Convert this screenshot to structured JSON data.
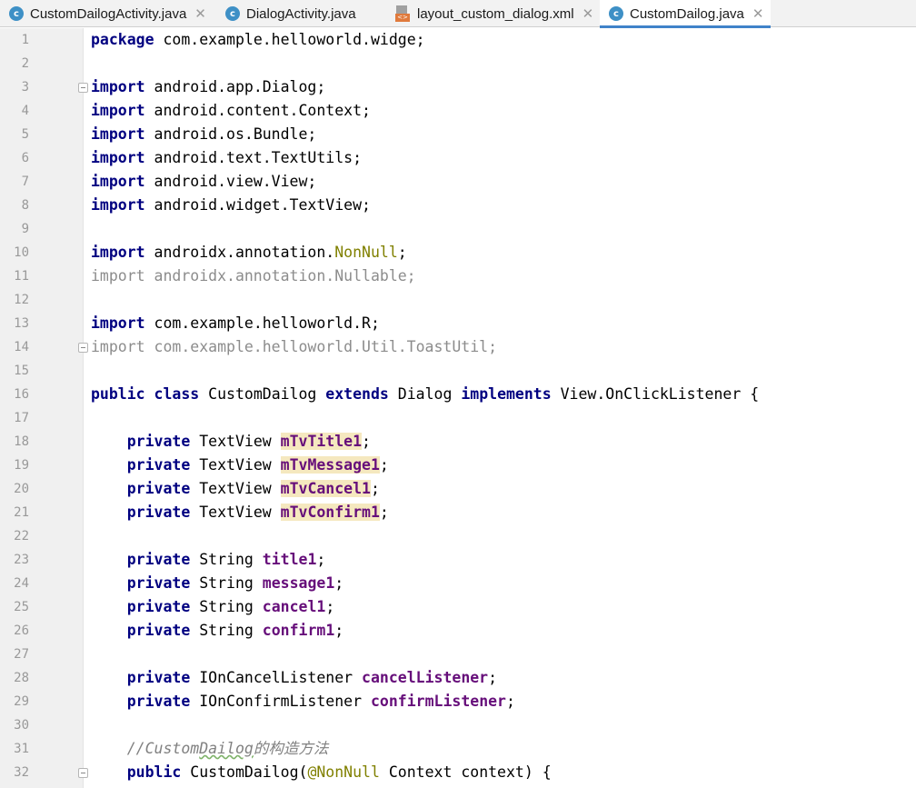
{
  "tabs": [
    {
      "label": "CustomDailogActivity.java",
      "icon": "java-class-icon",
      "icon_glyph": "c",
      "active": false,
      "closable": true
    },
    {
      "label": "DialogActivity.java",
      "icon": "java-class-icon",
      "icon_glyph": "c",
      "active": false,
      "closable": false
    },
    {
      "label": "layout_custom_dialog.xml",
      "icon": "xml-file-icon",
      "icon_glyph": "<>",
      "active": false,
      "closable": true
    },
    {
      "label": "CustomDailog.java",
      "icon": "java-class-icon",
      "icon_glyph": "c",
      "active": true,
      "closable": true
    }
  ],
  "tab_close_glyph": "✕",
  "colors": {
    "keyword": "#000080",
    "field": "#660e7a",
    "annotation": "#808000",
    "comment": "#808080",
    "unused": "#8c8c8c",
    "highlight": "#f5e8bf",
    "active_tab_underline": "#4083c9"
  },
  "editor": {
    "lines": [
      {
        "n": "1",
        "fold": false,
        "tokens": [
          {
            "t": "package",
            "c": "kw"
          },
          {
            "t": " com.example.helloworld.widge;"
          }
        ]
      },
      {
        "n": "2",
        "fold": false,
        "tokens": []
      },
      {
        "n": "3",
        "fold": true,
        "tokens": [
          {
            "t": "import",
            "c": "kw"
          },
          {
            "t": " android.app.Dialog;"
          }
        ]
      },
      {
        "n": "4",
        "fold": false,
        "tokens": [
          {
            "t": "import",
            "c": "kw"
          },
          {
            "t": " android.content.Context;"
          }
        ]
      },
      {
        "n": "5",
        "fold": false,
        "tokens": [
          {
            "t": "import",
            "c": "kw"
          },
          {
            "t": " android.os.Bundle;"
          }
        ]
      },
      {
        "n": "6",
        "fold": false,
        "tokens": [
          {
            "t": "import",
            "c": "kw"
          },
          {
            "t": " android.text.TextUtils;"
          }
        ]
      },
      {
        "n": "7",
        "fold": false,
        "tokens": [
          {
            "t": "import",
            "c": "kw"
          },
          {
            "t": " android.view.View;"
          }
        ]
      },
      {
        "n": "8",
        "fold": false,
        "tokens": [
          {
            "t": "import",
            "c": "kw"
          },
          {
            "t": " android.widget.TextView;"
          }
        ]
      },
      {
        "n": "9",
        "fold": false,
        "tokens": []
      },
      {
        "n": "10",
        "fold": false,
        "tokens": [
          {
            "t": "import",
            "c": "kw"
          },
          {
            "t": " androidx.annotation."
          },
          {
            "t": "NonNull",
            "c": "ann"
          },
          {
            "t": ";"
          }
        ]
      },
      {
        "n": "11",
        "fold": false,
        "tokens": [
          {
            "t": "import androidx.annotation.Nullable;",
            "c": "unused"
          }
        ]
      },
      {
        "n": "12",
        "fold": false,
        "tokens": []
      },
      {
        "n": "13",
        "fold": false,
        "tokens": [
          {
            "t": "import",
            "c": "kw"
          },
          {
            "t": " com.example.helloworld.R;"
          }
        ]
      },
      {
        "n": "14",
        "fold": true,
        "tokens": [
          {
            "t": "import com.example.helloworld.Util.ToastUtil;",
            "c": "unused"
          }
        ]
      },
      {
        "n": "15",
        "fold": false,
        "tokens": []
      },
      {
        "n": "16",
        "fold": false,
        "tokens": [
          {
            "t": "public class",
            "c": "kw"
          },
          {
            "t": " CustomDailog "
          },
          {
            "t": "extends",
            "c": "kw"
          },
          {
            "t": " Dialog "
          },
          {
            "t": "implements",
            "c": "kw"
          },
          {
            "t": " View.OnClickListener {"
          }
        ]
      },
      {
        "n": "17",
        "fold": false,
        "tokens": []
      },
      {
        "n": "18",
        "fold": false,
        "tokens": [
          {
            "t": "    "
          },
          {
            "t": "private",
            "c": "kw"
          },
          {
            "t": " TextView "
          },
          {
            "t": "mTvTitle1",
            "c": "field hl"
          },
          {
            "t": ";"
          }
        ]
      },
      {
        "n": "19",
        "fold": false,
        "tokens": [
          {
            "t": "    "
          },
          {
            "t": "private",
            "c": "kw"
          },
          {
            "t": " TextView "
          },
          {
            "t": "mTvMessage1",
            "c": "field hl"
          },
          {
            "t": ";"
          }
        ]
      },
      {
        "n": "20",
        "fold": false,
        "tokens": [
          {
            "t": "    "
          },
          {
            "t": "private",
            "c": "kw"
          },
          {
            "t": " TextView "
          },
          {
            "t": "mTvCancel1",
            "c": "field hl"
          },
          {
            "t": ";"
          }
        ]
      },
      {
        "n": "21",
        "fold": false,
        "tokens": [
          {
            "t": "    "
          },
          {
            "t": "private",
            "c": "kw"
          },
          {
            "t": " TextView "
          },
          {
            "t": "mTvConfirm1",
            "c": "field hl"
          },
          {
            "t": ";"
          }
        ]
      },
      {
        "n": "22",
        "fold": false,
        "tokens": []
      },
      {
        "n": "23",
        "fold": false,
        "tokens": [
          {
            "t": "    "
          },
          {
            "t": "private",
            "c": "kw"
          },
          {
            "t": " String "
          },
          {
            "t": "title1",
            "c": "field"
          },
          {
            "t": ";"
          }
        ]
      },
      {
        "n": "24",
        "fold": false,
        "tokens": [
          {
            "t": "    "
          },
          {
            "t": "private",
            "c": "kw"
          },
          {
            "t": " String "
          },
          {
            "t": "message1",
            "c": "field"
          },
          {
            "t": ";"
          }
        ]
      },
      {
        "n": "25",
        "fold": false,
        "tokens": [
          {
            "t": "    "
          },
          {
            "t": "private",
            "c": "kw"
          },
          {
            "t": " String "
          },
          {
            "t": "cancel1",
            "c": "field"
          },
          {
            "t": ";"
          }
        ]
      },
      {
        "n": "26",
        "fold": false,
        "tokens": [
          {
            "t": "    "
          },
          {
            "t": "private",
            "c": "kw"
          },
          {
            "t": " String "
          },
          {
            "t": "confirm1",
            "c": "field"
          },
          {
            "t": ";"
          }
        ]
      },
      {
        "n": "27",
        "fold": false,
        "tokens": []
      },
      {
        "n": "28",
        "fold": false,
        "tokens": [
          {
            "t": "    "
          },
          {
            "t": "private",
            "c": "kw"
          },
          {
            "t": " IOnCancelListener "
          },
          {
            "t": "cancelListener",
            "c": "field"
          },
          {
            "t": ";"
          }
        ]
      },
      {
        "n": "29",
        "fold": false,
        "tokens": [
          {
            "t": "    "
          },
          {
            "t": "private",
            "c": "kw"
          },
          {
            "t": " IOnConfirmListener "
          },
          {
            "t": "confirmListener",
            "c": "field"
          },
          {
            "t": ";"
          }
        ]
      },
      {
        "n": "30",
        "fold": false,
        "tokens": []
      },
      {
        "n": "31",
        "fold": false,
        "tokens": [
          {
            "t": "    "
          },
          {
            "t": "//Custom",
            "c": "comment"
          },
          {
            "t": "Dailog",
            "c": "comment squig"
          },
          {
            "t": "的构造方法",
            "c": "comment"
          }
        ]
      },
      {
        "n": "32",
        "fold": true,
        "tokens": [
          {
            "t": "    "
          },
          {
            "t": "public",
            "c": "kw"
          },
          {
            "t": " CustomDailog("
          },
          {
            "t": "@NonNull",
            "c": "ann"
          },
          {
            "t": " Context context) {"
          }
        ]
      }
    ]
  }
}
